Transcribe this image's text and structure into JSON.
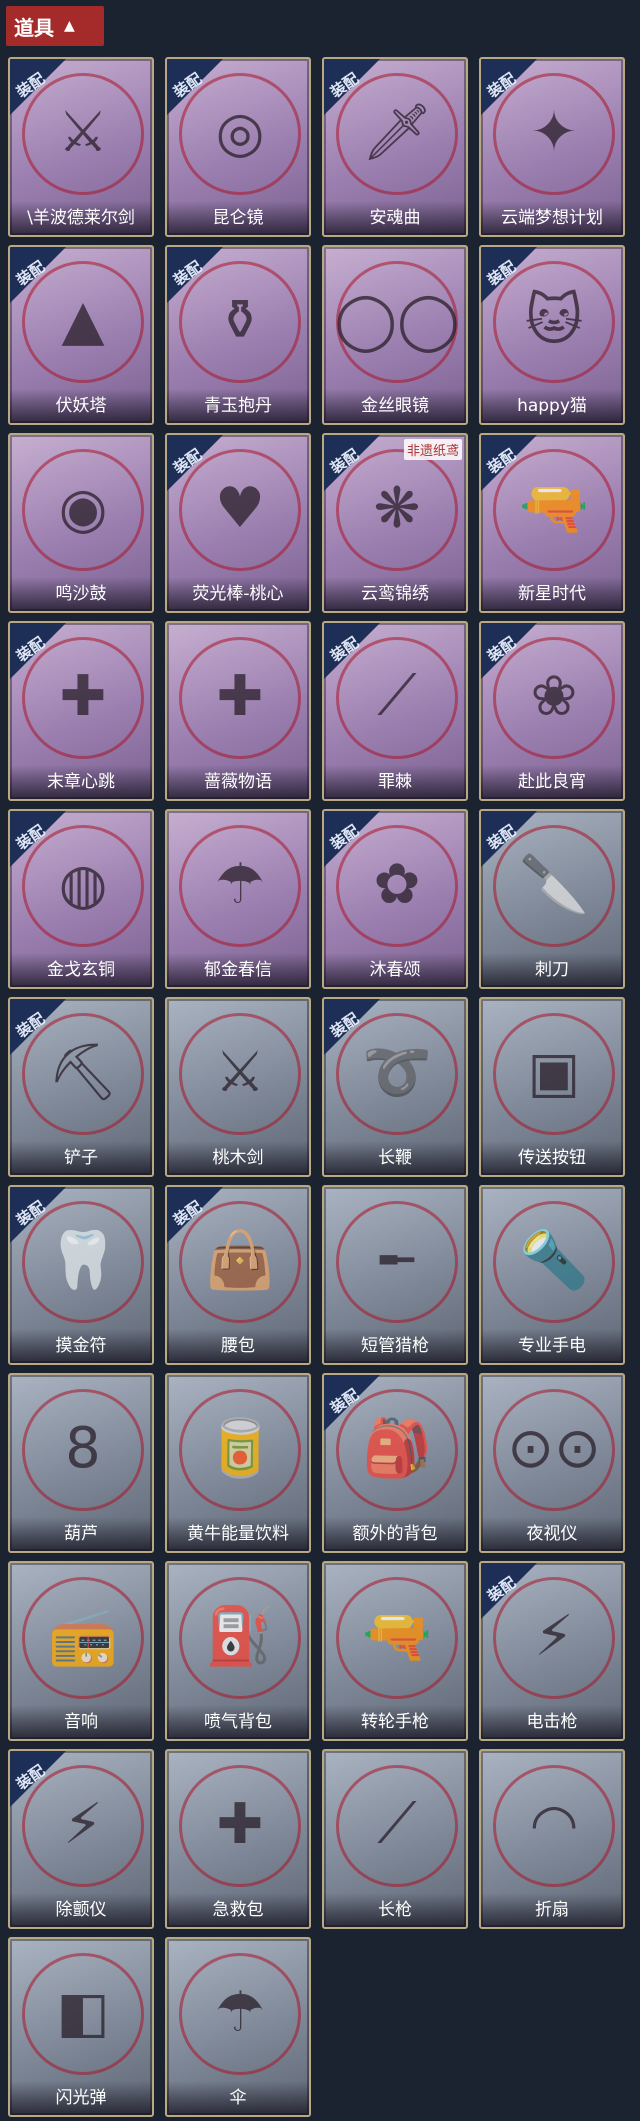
{
  "header": {
    "title": "道具",
    "caret": "▲"
  },
  "badge_text": "装配",
  "items": [
    {
      "label": "\\羊波德莱尔剑",
      "equipped": true,
      "theme": "purple",
      "icon": "sword-icon",
      "glyph": "⚔"
    },
    {
      "label": "昆仑镜",
      "equipped": true,
      "theme": "purple",
      "icon": "mirror-icon",
      "glyph": "◎"
    },
    {
      "label": "安魂曲",
      "equipped": true,
      "theme": "purple",
      "icon": "blade-icon",
      "glyph": "🗡"
    },
    {
      "label": "云端梦想计划",
      "equipped": true,
      "theme": "purple",
      "icon": "wand-icon",
      "glyph": "✦"
    },
    {
      "label": "伏妖塔",
      "equipped": true,
      "theme": "purple",
      "icon": "pagoda-icon",
      "glyph": "▲"
    },
    {
      "label": "青玉抱丹",
      "equipped": true,
      "theme": "purple",
      "icon": "vase-icon",
      "glyph": "⚱"
    },
    {
      "label": "金丝眼镜",
      "equipped": false,
      "theme": "purple",
      "icon": "glasses-icon",
      "glyph": "◯◯"
    },
    {
      "label": "happy猫",
      "equipped": true,
      "theme": "purple",
      "icon": "cat-icon",
      "glyph": "🐱"
    },
    {
      "label": "鸣沙鼓",
      "equipped": false,
      "theme": "purple",
      "icon": "drum-icon",
      "glyph": "◉"
    },
    {
      "label": "荧光棒-桃心",
      "equipped": true,
      "theme": "purple",
      "icon": "heart-wand-icon",
      "glyph": "♥"
    },
    {
      "label": "云鸾锦绣",
      "equipped": true,
      "theme": "purple",
      "icon": "ornament-icon",
      "glyph": "❋",
      "corner": "非遗纸鸢"
    },
    {
      "label": "新星时代",
      "equipped": true,
      "theme": "purple",
      "icon": "revolver-icon",
      "glyph": "🔫"
    },
    {
      "label": "末章心跳",
      "equipped": true,
      "theme": "purple",
      "icon": "scepter-icon",
      "glyph": "✚"
    },
    {
      "label": "蔷薇物语",
      "equipped": false,
      "theme": "purple",
      "icon": "medkit-icon",
      "glyph": "✚"
    },
    {
      "label": "罪棘",
      "equipped": true,
      "theme": "purple",
      "icon": "spear-icon",
      "glyph": "⟋"
    },
    {
      "label": "赴此良宵",
      "equipped": true,
      "theme": "purple",
      "icon": "fan-icon",
      "glyph": "❀"
    },
    {
      "label": "金戈玄铜",
      "equipped": true,
      "theme": "purple",
      "icon": "grenade-icon",
      "glyph": "◍"
    },
    {
      "label": "郁金春信",
      "equipped": false,
      "theme": "purple",
      "icon": "parasol-icon",
      "glyph": "☂"
    },
    {
      "label": "沐春颂",
      "equipped": true,
      "theme": "purple",
      "icon": "flower-umbrella-icon",
      "glyph": "✿"
    },
    {
      "label": "刺刀",
      "equipped": true,
      "theme": "gray",
      "icon": "knife-icon",
      "glyph": "🔪"
    },
    {
      "label": "铲子",
      "equipped": true,
      "theme": "gray",
      "icon": "shovel-icon",
      "glyph": "⛏"
    },
    {
      "label": "桃木剑",
      "equipped": false,
      "theme": "gray",
      "icon": "wooden-sword-icon",
      "glyph": "⚔"
    },
    {
      "label": "长鞭",
      "equipped": true,
      "theme": "gray",
      "icon": "whip-icon",
      "glyph": "➰"
    },
    {
      "label": "传送按钮",
      "equipped": false,
      "theme": "gray",
      "icon": "teleport-button-icon",
      "glyph": "▣"
    },
    {
      "label": "摸金符",
      "equipped": true,
      "theme": "gray",
      "icon": "talisman-icon",
      "glyph": "🦷"
    },
    {
      "label": "腰包",
      "equipped": true,
      "theme": "gray",
      "icon": "waist-bag-icon",
      "glyph": "👜"
    },
    {
      "label": "短管猎枪",
      "equipped": false,
      "theme": "gray",
      "icon": "shotgun-icon",
      "glyph": "╾"
    },
    {
      "label": "专业手电",
      "equipped": false,
      "theme": "gray",
      "icon": "flashlight-icon",
      "glyph": "🔦"
    },
    {
      "label": "葫芦",
      "equipped": false,
      "theme": "gray",
      "icon": "gourd-icon",
      "glyph": "8"
    },
    {
      "label": "黄牛能量饮料",
      "equipped": false,
      "theme": "gray",
      "icon": "energy-drink-icon",
      "glyph": "🥫"
    },
    {
      "label": "额外的背包",
      "equipped": true,
      "theme": "gray",
      "icon": "backpack-icon",
      "glyph": "🎒"
    },
    {
      "label": "夜视仪",
      "equipped": false,
      "theme": "gray",
      "icon": "night-vision-icon",
      "glyph": "⊙⊙"
    },
    {
      "label": "音响",
      "equipped": false,
      "theme": "gray",
      "icon": "speaker-icon",
      "glyph": "📻"
    },
    {
      "label": "喷气背包",
      "equipped": false,
      "theme": "gray",
      "icon": "jetpack-icon",
      "glyph": "⛽"
    },
    {
      "label": "转轮手枪",
      "equipped": false,
      "theme": "gray",
      "icon": "pistol-icon",
      "glyph": "🔫"
    },
    {
      "label": "电击枪",
      "equipped": true,
      "theme": "gray",
      "icon": "stun-gun-icon",
      "glyph": "⚡"
    },
    {
      "label": "除颤仪",
      "equipped": true,
      "theme": "gray",
      "icon": "defibrillator-icon",
      "glyph": "⚡"
    },
    {
      "label": "急救包",
      "equipped": false,
      "theme": "gray",
      "icon": "first-aid-icon",
      "glyph": "✚"
    },
    {
      "label": "长枪",
      "equipped": false,
      "theme": "gray",
      "icon": "lance-icon",
      "glyph": "⟋"
    },
    {
      "label": "折扇",
      "equipped": false,
      "theme": "gray",
      "icon": "folding-fan-icon",
      "glyph": "◠"
    },
    {
      "label": "闪光弹",
      "equipped": false,
      "theme": "gray",
      "icon": "flashbang-icon",
      "glyph": "◧"
    },
    {
      "label": "伞",
      "equipped": false,
      "theme": "gray",
      "icon": "umbrella-icon",
      "glyph": "☂"
    }
  ]
}
